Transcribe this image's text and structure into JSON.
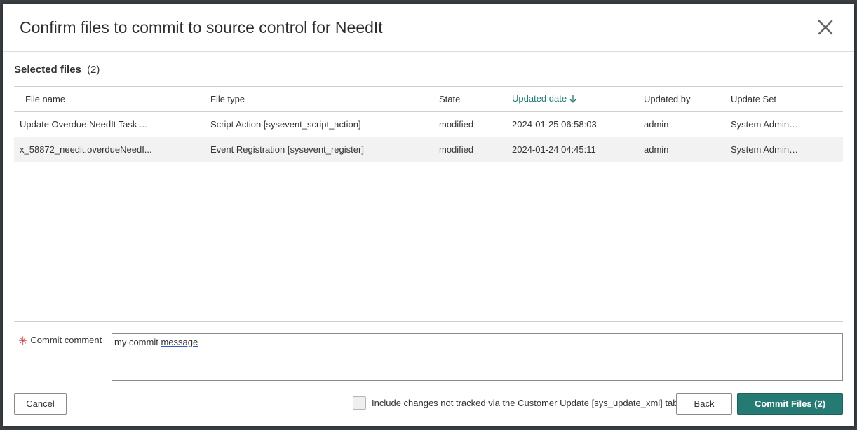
{
  "dialog": {
    "title": "Confirm files to commit to source control for NeedIt"
  },
  "section": {
    "title": "Selected files",
    "count": "(2)"
  },
  "table": {
    "columns": [
      "File name",
      "File type",
      "State",
      "Updated date",
      "Updated by",
      "Update Set"
    ],
    "sorted_column": "Updated date",
    "sort_direction": "descending",
    "rows": [
      [
        "Update Overdue NeedIt Task ...",
        "Script Action [sysevent_script_action]",
        "modified",
        "2024-01-25 06:58:03",
        "admin",
        "System Admin…"
      ],
      [
        "x_58872_needit.overdueNeedI...",
        "Event Registration [sysevent_register]",
        "modified",
        "2024-01-24 04:45:11",
        "admin",
        "System Admin…"
      ]
    ]
  },
  "comment": {
    "label": "Commit comment",
    "value_part1": "my commit ",
    "value_part2": "message"
  },
  "footer": {
    "cancel_label": "Cancel",
    "include_label": "Include changes not tracked via the Customer Update [sys_update_xml] table",
    "include_checked": false,
    "back_label": "Back",
    "commit_label": "Commit Files (2)"
  },
  "colors": {
    "primary": "#257a73",
    "sorted_header": "#1f7a73",
    "required": "#c83c3c"
  },
  "icons": {
    "close": "close-icon",
    "sort": "arrow-down-icon",
    "required": "required-asterisk-icon"
  }
}
